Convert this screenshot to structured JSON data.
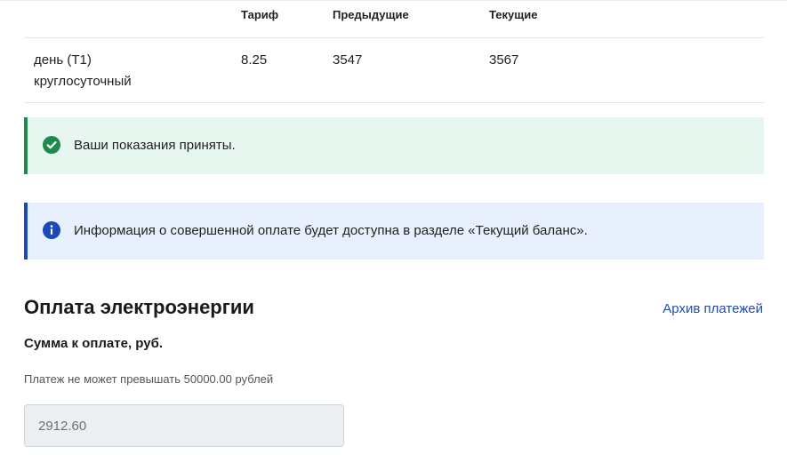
{
  "table": {
    "headers": {
      "tariff": "Тариф",
      "previous": "Предыдущие",
      "current": "Текущие"
    },
    "rows": [
      {
        "zone": "день (Т1)",
        "zone_note": "круглосуточный",
        "tariff": "8.25",
        "previous": "3547",
        "current": "3567"
      }
    ]
  },
  "alerts": {
    "success": {
      "icon": "check-circle-icon",
      "text": "Ваши показания приняты.",
      "color": "#1e8a4c"
    },
    "info": {
      "icon": "info-circle-icon",
      "text": "Информация о совершенной оплате будет доступна в разделе «Текущий баланс».",
      "color": "#1a48b8"
    }
  },
  "payment": {
    "title": "Оплата электроэнергии",
    "archive_link": "Архив платежей",
    "amount_label": "Сумма к оплате, руб.",
    "limit_note": "Платеж не может превышать 50000.00 рублей",
    "amount_value": "2912.60"
  },
  "colors": {
    "link": "#1f4cb5",
    "success_bg": "#e7f7ef",
    "info_bg": "#e9f0fd"
  }
}
